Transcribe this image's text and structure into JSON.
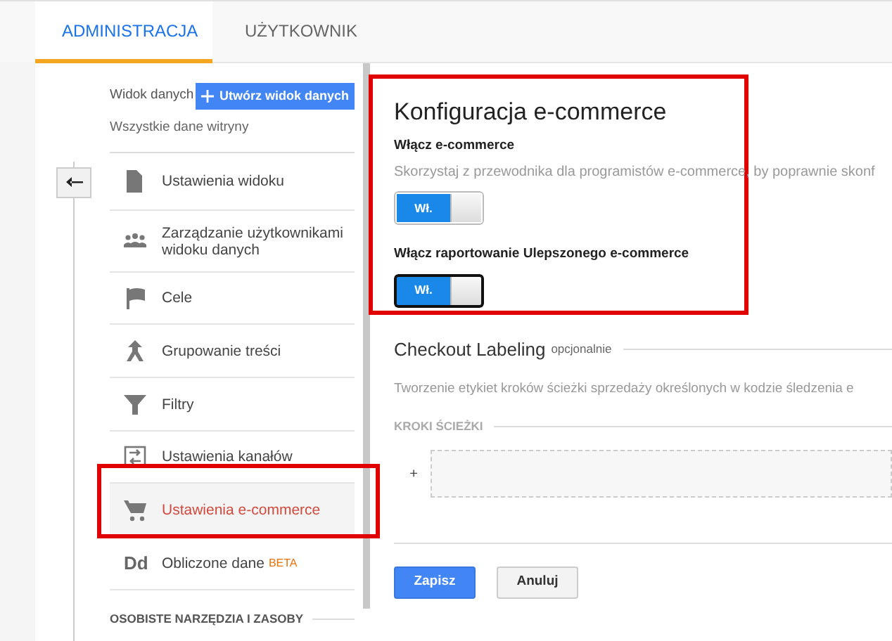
{
  "tabs": [
    {
      "label": "ADMINISTRACJA",
      "selected": true
    },
    {
      "label": "UŻYTKOWNIK",
      "selected": false
    }
  ],
  "view": {
    "label": "Widok danych",
    "create_button": "Utwórz widok danych",
    "current": "Wszystkie dane witryny"
  },
  "nav": [
    {
      "label": "Ustawienia widoku",
      "selected": false
    },
    {
      "label": "Zarządzanie użytkownikami widoku danych",
      "selected": false
    },
    {
      "label": "Cele",
      "selected": false
    },
    {
      "label": "Grupowanie treści",
      "selected": false
    },
    {
      "label": "Filtry",
      "selected": false
    },
    {
      "label": "Ustawienia kanałów",
      "selected": false
    },
    {
      "label": "Ustawienia e-commerce",
      "selected": true
    },
    {
      "label": "Obliczone dane",
      "icon_text": "Dd",
      "badge": "BETA",
      "selected": false
    }
  ],
  "nav_section": "OSOBISTE NARZĘDZIA I ZASOBY",
  "config": {
    "title": "Konfiguracja e-commerce",
    "settings": [
      {
        "label": "Włącz e-commerce",
        "description": "Skorzystaj z przewodnika dla programistów e-commerce, by poprawnie skonf",
        "toggle": "Wł.",
        "on": true,
        "focused": false
      },
      {
        "label": "Włącz raportowanie Ulepszonego e-commerce",
        "toggle": "Wł.",
        "on": true,
        "focused": true
      }
    ]
  },
  "checkout": {
    "title": "Checkout Labeling",
    "note": "opcjonalnie",
    "description": "Tworzenie etykiet kroków ścieżki sprzedaży określonych w kodzie śledzenia e",
    "steps_heading": "KROKI ŚCIEŻKI",
    "add": "+"
  },
  "buttons": [
    {
      "label": "Zapisz",
      "kind": "primary"
    },
    {
      "label": "Anuluj",
      "kind": "secondary"
    }
  ]
}
